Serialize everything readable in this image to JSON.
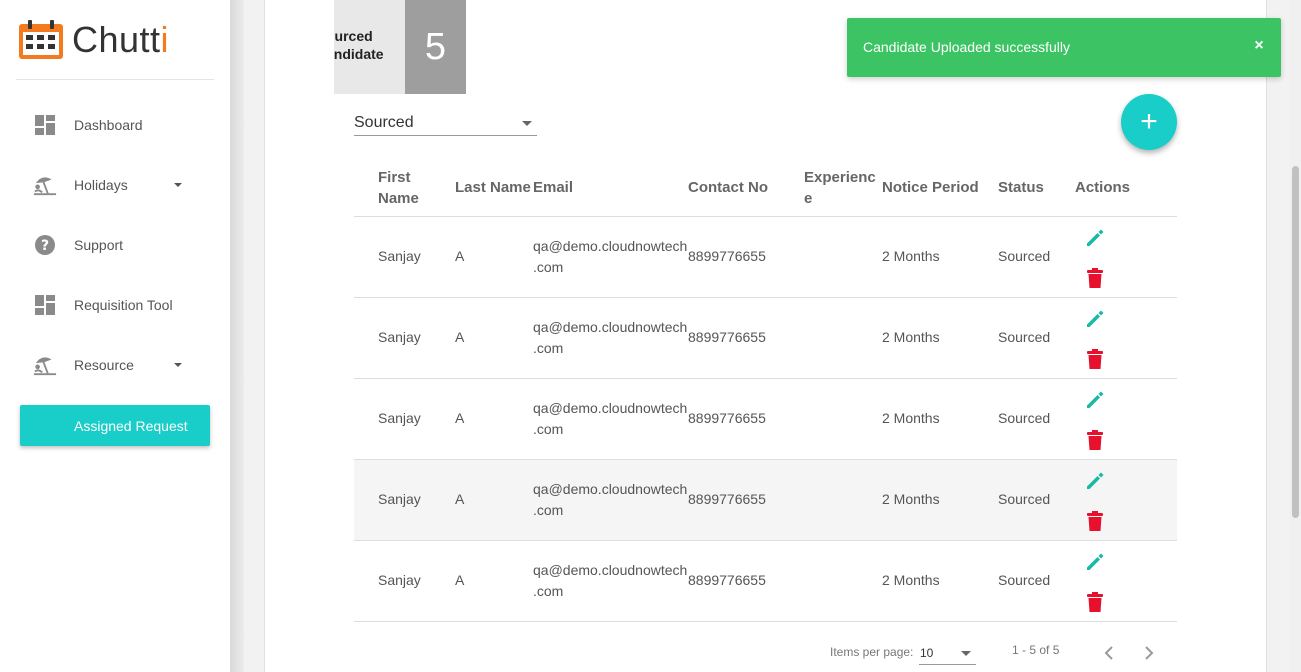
{
  "app": {
    "logo_text_main": "Chutt",
    "logo_text_accent": "i"
  },
  "sidebar": {
    "items": [
      {
        "label": "Dashboard",
        "icon": "dashboard-icon",
        "has_dropdown": false
      },
      {
        "label": "Holidays",
        "icon": "beach-icon",
        "has_dropdown": true
      },
      {
        "label": "Support",
        "icon": "help-icon",
        "has_dropdown": false
      },
      {
        "label": "Requisition Tool",
        "icon": "dashboard-icon",
        "has_dropdown": false
      },
      {
        "label": "Resource",
        "icon": "beach-icon",
        "has_dropdown": true
      }
    ],
    "assigned_button": "Assigned Request"
  },
  "stat": {
    "label_line1": "ourced",
    "label_line2": "andidate",
    "count": "5"
  },
  "filter": {
    "selected": "Sourced"
  },
  "fab": {
    "symbol": "+"
  },
  "table": {
    "headers": {
      "first_name_1": "First",
      "first_name_2": "Name",
      "last_name": "Last Name",
      "email": "Email",
      "contact": "Contact No",
      "experience_1": "Experienc",
      "experience_2": "e",
      "notice": "Notice Period",
      "status": "Status",
      "actions": "Actions"
    },
    "rows": [
      {
        "first": "Sanjay",
        "last": "A",
        "email_1": "qa@demo.cloudnowtech",
        "email_2": ".com",
        "contact": "8899776655",
        "experience": "",
        "notice": "2 Months",
        "status": "Sourced"
      },
      {
        "first": "Sanjay",
        "last": "A",
        "email_1": "qa@demo.cloudnowtech",
        "email_2": ".com",
        "contact": "8899776655",
        "experience": "",
        "notice": "2 Months",
        "status": "Sourced"
      },
      {
        "first": "Sanjay",
        "last": "A",
        "email_1": "qa@demo.cloudnowtech",
        "email_2": ".com",
        "contact": "8899776655",
        "experience": "",
        "notice": "2 Months",
        "status": "Sourced"
      },
      {
        "first": "Sanjay",
        "last": "A",
        "email_1": "qa@demo.cloudnowtech",
        "email_2": ".com",
        "contact": "8899776655",
        "experience": "",
        "notice": "2 Months",
        "status": "Sourced"
      },
      {
        "first": "Sanjay",
        "last": "A",
        "email_1": "qa@demo.cloudnowtech",
        "email_2": ".com",
        "contact": "8899776655",
        "experience": "",
        "notice": "2 Months",
        "status": "Sourced"
      }
    ]
  },
  "pager": {
    "items_label": "Items per page:",
    "page_size": "10",
    "range": "1 - 5 of 5"
  },
  "toast": {
    "message": "Candidate Uploaded successfully",
    "close": "×"
  },
  "colors": {
    "accent": "#19cdc8",
    "toast": "#3cc464",
    "delete": "#e8112d",
    "logo_orange": "#f47a20"
  }
}
